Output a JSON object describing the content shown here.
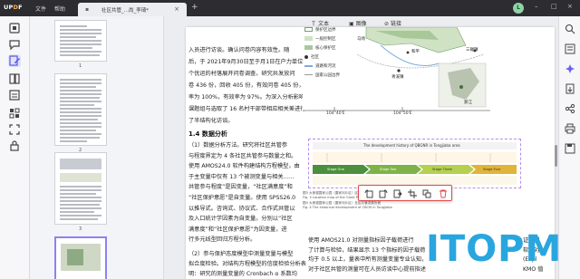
{
  "app": {
    "logo_prefix": "UP",
    "logo_f": "D",
    "logo_suffix": "F"
  },
  "menu": {
    "file": "文件",
    "help": "帮助"
  },
  "tab": {
    "title": "社区共管_...尚_李琦*",
    "close": "×",
    "add": "+"
  },
  "avatar": {
    "initial": "L"
  },
  "window": {
    "minimize": "–",
    "maximize": "□",
    "close": "×"
  },
  "context_toolbar": {
    "text": "文本",
    "image": "图像",
    "link": "链接"
  },
  "thumbnails": [
    {
      "page": "1"
    },
    {
      "page": "2"
    },
    {
      "page": "3"
    }
  ],
  "document": {
    "lines_top": [
      "入员进行访谈。确认问卷内容有效性。随",
      "后，于 2021年9月30日至于月1日在户力单位主",
      "个优运的村落展开问卷调查。研究共发放问",
      "卷 436 份，回收 405 份，有效问卷 405 份，回收",
      "率为 100%，有效率为 97%。为深入分析影响机制，",
      "课题组与选取了 16 名村干部带相应相关差进行",
      "了半结构化访谈。"
    ],
    "section_heading": "1.4  数据分析",
    "lines_bottom": [
      "（1）数据分析方法。研究将社区共管参",
      "与程度界定为 4 条社区共管参与数量之和。",
      "使用 AMOS24.0 软件构建结构方程模型，由",
      "于主变量中仅有 13 个被测变量与相关……",
      "共管参与程度”是因变量，“社区满意度”和",
      "“社区保护意愿”是自变量。使用 SPSS26.0",
      "以推导式。咨询式、协议式、合作式共管以",
      "及入口统计学因素为自变量。分别以“社区",
      "满意度”和“社区保护意愿”为因变量，进",
      "行多元线型回归方程分析。"
    ],
    "lines_end": [
      "（2）参与保护态度模型中测量变量与模型",
      "拟合度检验。对结构方程模型的信度检验分析表",
      "明：研究的测量变量的 Cronbach α 系数均",
      "584。大于 0.7，表明样本数据信度较为一致"
    ],
    "lines_right": [
      "使用 AMOS21.0 对测量指标因子载荷进行",
      "了计算与检验，结果显示 13 个指标的因子载荷",
      "均于 0.5 以上，量表中所有测量变量专业认知，",
      "对于社区共管的测量可在人员访谈中心提前指述"
    ],
    "lines_right_far": [
      "证模型",
      "软件对",
      "(Expl",
      "KMO 值"
    ],
    "map_legend": [
      "保护区边界",
      "一般控制区",
      "核心保护区",
      "社区",
      "道路和河流",
      "国家公园边界"
    ],
    "map_labels": [
      "三碾镇",
      "和平",
      "青溪镇",
      "马场",
      "浙江"
    ],
    "coords": [
      "104°40'E",
      "104°50'E"
    ],
    "timeline_title": "The development history of QBGNR in Tongjiaba area",
    "timeline_stages": [
      "Stage One",
      "Stage Two",
      "Stage Three",
      "Stage Four"
    ],
    "captions": [
      "图3  大熊猫国家公园（唐家河片区）区位与规划 (a)",
      "Fig. 3   Location map of  the  Giant Panda National Park (Tangjiahe Area)",
      "图4  大熊猫国家公园（唐家河片区）社区共管发展历程",
      "Fig. 4   The historical development of  CBCM in Tongjiaba"
    ]
  },
  "floating_toolbar": [
    "rotate-left-icon",
    "rotate-right-icon",
    "extract-icon",
    "crop-icon",
    "replace-icon",
    "delete-icon"
  ],
  "colors": {
    "accent": "#8a83f0",
    "delete": "#e04a4a",
    "watermark": "#2aa6df"
  },
  "watermark": "ITOPM"
}
